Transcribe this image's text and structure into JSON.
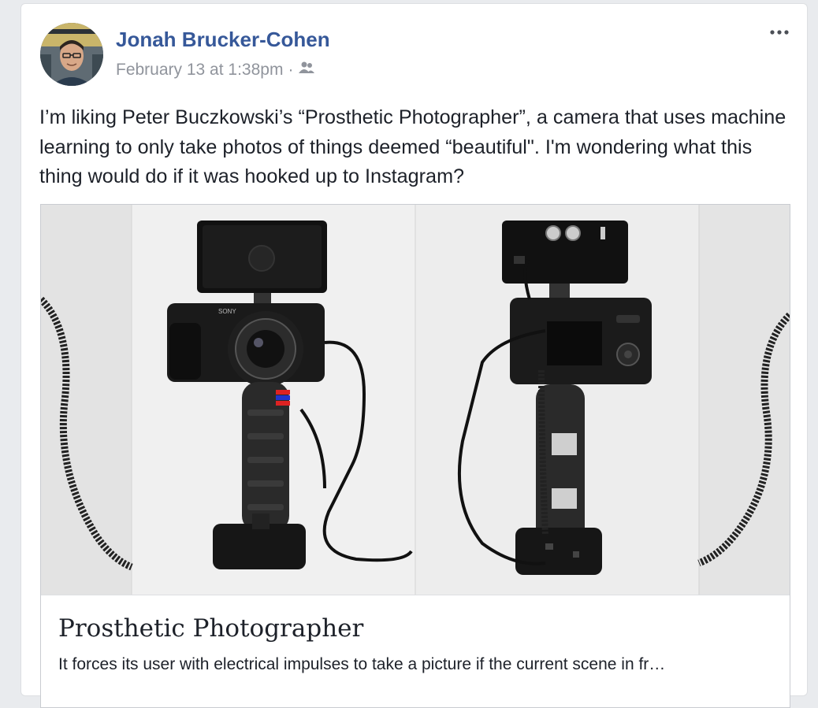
{
  "post": {
    "author_name": "Jonah Brucker-Cohen",
    "timestamp": "February 13 at 1:38pm",
    "separator": "·",
    "audience_icon": "friends-icon",
    "more_icon": "more-options-icon",
    "text": "I’m liking Peter Buczkowski’s “Prosthetic Photographer”, a camera that uses machine learning to only take photos of things deemed “beautiful\". I'm wondering what this thing would do if it was hooked up to Instagram?"
  },
  "link_preview": {
    "title": "Prosthetic Photographer",
    "description": "It forces its user with electrical impulses to take a picture if the current scene in fr…"
  },
  "colors": {
    "author_link": "#365899",
    "meta_text": "#90949c",
    "body_text": "#1d2129",
    "card_border": "#dddfe2",
    "page_background": "#e9ebee"
  }
}
